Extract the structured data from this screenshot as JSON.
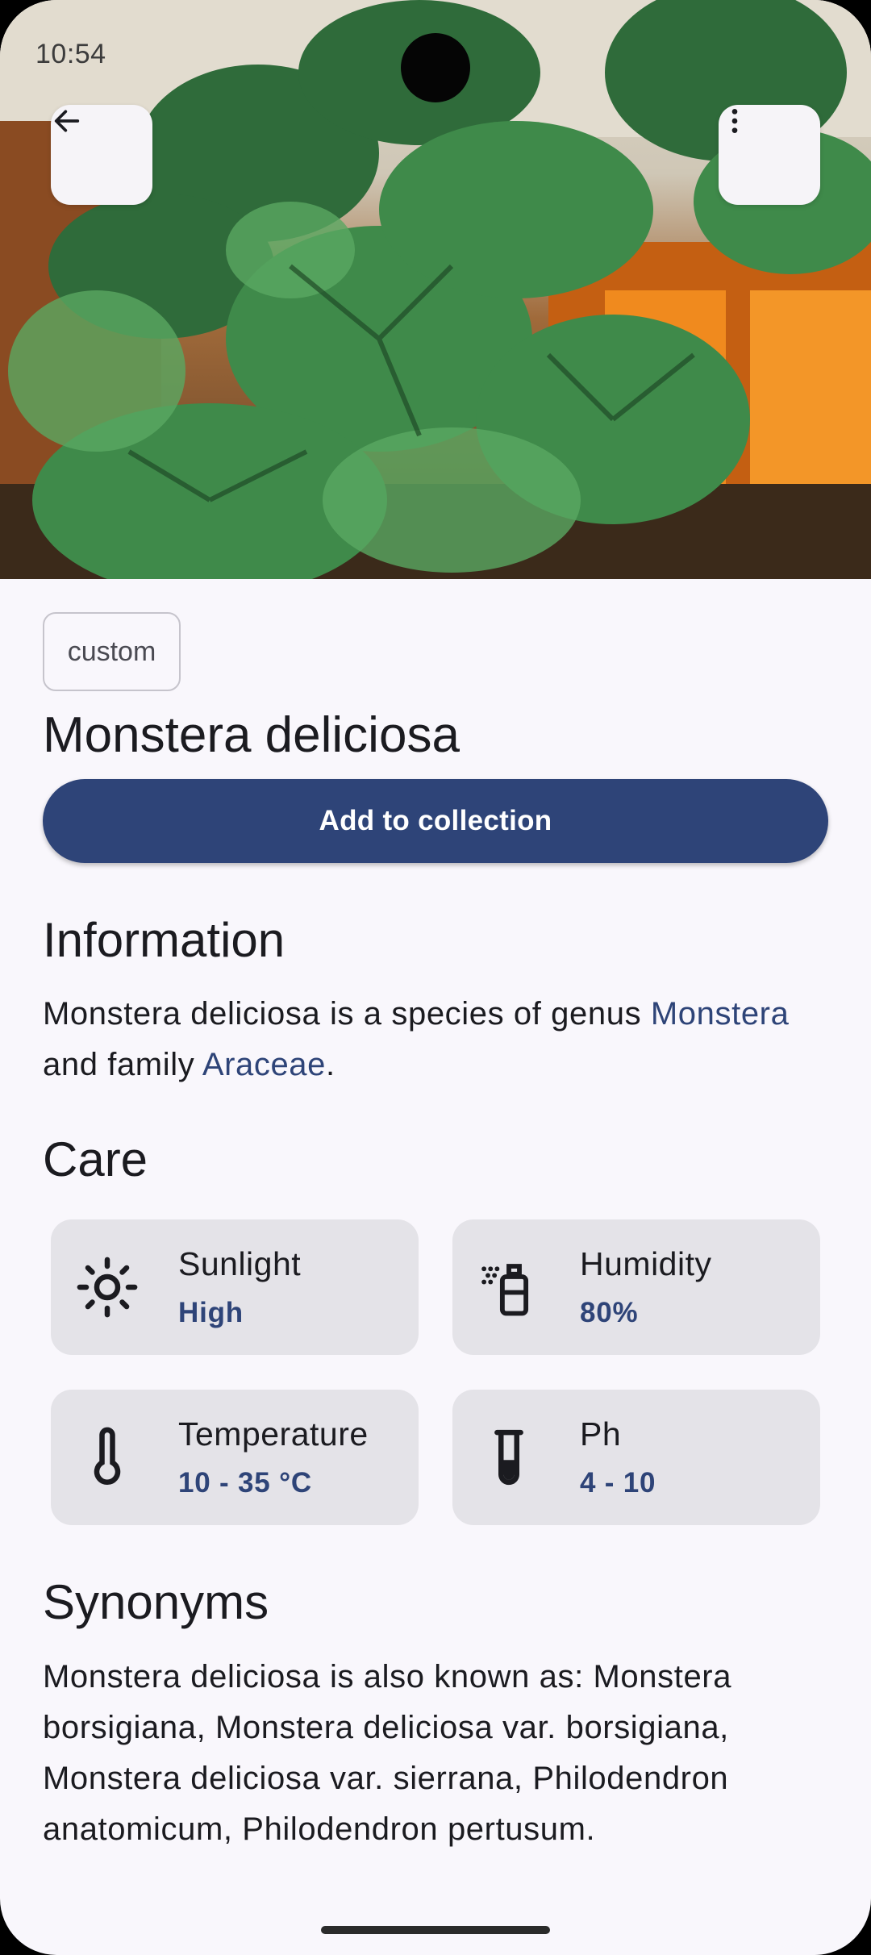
{
  "status_bar": {
    "time": "10:54"
  },
  "hero": {
    "back_icon": "arrow-left-icon",
    "menu_icon": "more-vertical-icon"
  },
  "plant": {
    "tag": "custom",
    "name": "Monstera deliciosa",
    "add_button": "Add to collection"
  },
  "information": {
    "heading": "Information",
    "text_prefix": "Monstera deliciosa is a species of genus ",
    "genus": "Monstera",
    "text_middle": " and family ",
    "family": "Araceae",
    "text_suffix": "."
  },
  "care": {
    "heading": "Care",
    "items": [
      {
        "label": "Sunlight",
        "value": "High",
        "icon": "sun-icon"
      },
      {
        "label": "Humidity",
        "value": "80%",
        "icon": "spray-bottle-icon"
      },
      {
        "label": "Temperature",
        "value": "10 - 35 °C",
        "icon": "thermometer-icon"
      },
      {
        "label": "Ph",
        "value": "4 - 10",
        "icon": "test-tube-icon"
      }
    ]
  },
  "synonyms": {
    "heading": "Synonyms",
    "text": "Monstera deliciosa is also known as: Monstera borsigiana, Monstera deliciosa var. borsigiana, Monstera deliciosa var. sierrana, Philodendron anatomicum, Philodendron pertusum."
  },
  "colors": {
    "accent": "#2e4478",
    "background": "#f9f7fc",
    "card": "#e4e3e8"
  }
}
